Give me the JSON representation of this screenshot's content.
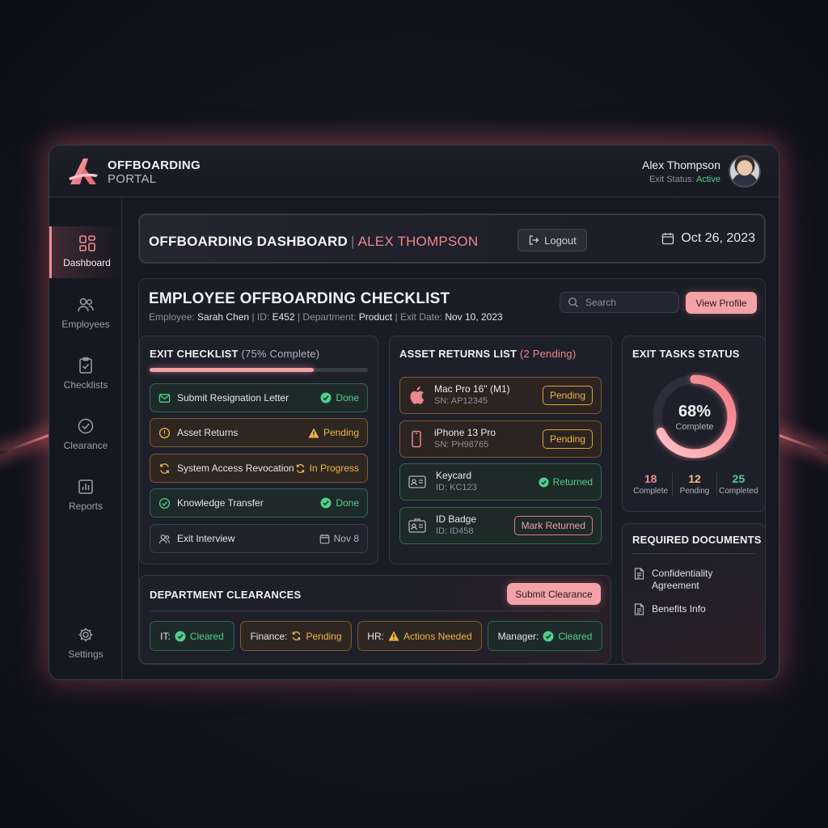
{
  "brand": {
    "line1": "OFFBOARDING",
    "line2": "PORTAL"
  },
  "user": {
    "name": "Alex Thompson",
    "status_label": "Exit Status:",
    "status_value": "Active"
  },
  "sidebar": {
    "items": [
      {
        "label": "Dashboard",
        "icon": "grid-icon",
        "active": true
      },
      {
        "label": "Employees",
        "icon": "users-icon"
      },
      {
        "label": "Checklists",
        "icon": "clipboard-check-icon"
      },
      {
        "label": "Clearance",
        "icon": "check-circle-icon"
      },
      {
        "label": "Reports",
        "icon": "bar-chart-icon"
      }
    ],
    "settings_label": "Settings"
  },
  "header": {
    "title": "OFFBOARDING DASHBOARD",
    "separator": "|",
    "name": "ALEX THOMPSON",
    "logout_label": "Logout",
    "date": "Oct 26, 2023"
  },
  "checklist": {
    "title": "EMPLOYEE OFFBOARDING CHECKLIST",
    "meta": {
      "employee_label": "Employee:",
      "employee": "Sarah Chen",
      "id_label": "ID:",
      "id": "E452",
      "dept_label": "Department:",
      "dept": "Product",
      "exit_label": "Exit Date:",
      "exit": "Nov 10, 2023"
    },
    "search_placeholder": "Search",
    "view_profile_label": "View Profile"
  },
  "exit_checklist": {
    "title": "EXIT CHECKLIST",
    "percent_text": "(75% Complete)",
    "progress": 0.75,
    "tasks": [
      {
        "label": "Submit Resignation Letter",
        "status": "Done",
        "icon": "mail-icon",
        "status_icon": "check-circle-icon"
      },
      {
        "label": "Asset Returns",
        "status": "Pending",
        "icon": "alert-circle-icon",
        "status_icon": "warning-icon"
      },
      {
        "label": "System Access Revocation",
        "status": "In Progress",
        "icon": "refresh-icon",
        "status_icon": "refresh-icon"
      },
      {
        "label": "Knowledge Transfer",
        "status": "Done",
        "icon": "check-circle-icon",
        "status_icon": "check-circle-icon"
      },
      {
        "label": "Exit Interview",
        "status": "Nov 8",
        "icon": "users-icon",
        "status_icon": "calendar-icon"
      }
    ]
  },
  "assets": {
    "title": "ASSET RETURNS LIST",
    "pending_text": "(2 Pending)",
    "items": [
      {
        "name": "Mac Pro 16\" (M1)",
        "id": "SN: AP12345",
        "status": "Pending",
        "icon": "apple-icon"
      },
      {
        "name": "iPhone 13 Pro",
        "id": "SN: PH98765",
        "status": "Pending",
        "icon": "phone-icon"
      },
      {
        "name": "Keycard",
        "id": "ID: KC123",
        "status": "Returned",
        "icon": "id-card-icon"
      },
      {
        "name": "ID Badge",
        "id": "ID: ID458",
        "status": "Mark Returned",
        "icon": "badge-icon"
      }
    ]
  },
  "exit_tasks": {
    "title": "EXIT TASKS STATUS",
    "percent": "68%",
    "percent_value": 68,
    "percent_label": "Complete",
    "stats": [
      {
        "value": "18",
        "label": "Complete",
        "color": "#f08a92"
      },
      {
        "value": "12",
        "label": "Pending",
        "color": "#f0c07a"
      },
      {
        "value": "25",
        "label": "Completed",
        "color": "#4fd08a"
      }
    ]
  },
  "documents": {
    "title": "REQUIRED DOCUMENTS",
    "items": [
      {
        "line1": "Confidentiality",
        "line2": "Agreement"
      },
      {
        "line1": "Benefits Info",
        "line2": ""
      }
    ]
  },
  "clearances": {
    "title": "DEPARTMENT CLEARANCES",
    "submit_label": "Submit Clearance",
    "items": [
      {
        "dept": "IT:",
        "status": "Cleared"
      },
      {
        "dept": "Finance:",
        "status": "Pending"
      },
      {
        "dept": "HR:",
        "status": "Actions Needed"
      },
      {
        "dept": "Manager:",
        "status": "Cleared"
      }
    ]
  },
  "colors": {
    "accent": "#f3a3a8",
    "success": "#4fd08a",
    "warning": "#f0b44a",
    "danger": "#f0868e"
  }
}
